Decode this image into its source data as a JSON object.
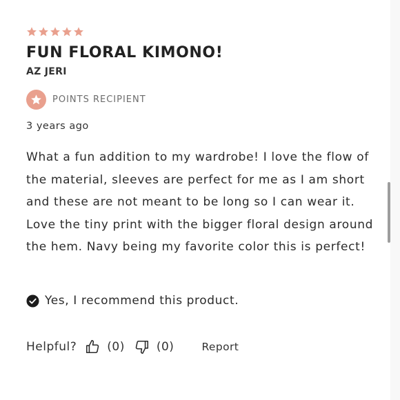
{
  "review": {
    "rating": 5,
    "rating_max": 5,
    "star_color": "#e9a08e",
    "title": "FUN FLORAL KIMONO!",
    "author": "AZ JERI",
    "badge": {
      "label": "POINTS RECIPIENT",
      "icon": "star-icon",
      "color": "#e9a08e"
    },
    "time_ago": "3 years ago",
    "body": "What a fun addition to my wardrobe! I love the flow of the material, sleeves are perfect for me as I am short and these are not meant to be long so I can wear it. Love the tiny print with the bigger floral design around the hem. Navy being my favorite color this is perfect!",
    "recommend": {
      "icon": "check-circle-icon",
      "text": "Yes, I recommend this product."
    },
    "helpful": {
      "label": "Helpful?",
      "up_icon": "thumbs-up-icon",
      "up_count": "(0)",
      "down_icon": "thumbs-down-icon",
      "down_count": "(0)",
      "report_label": "Report"
    }
  }
}
